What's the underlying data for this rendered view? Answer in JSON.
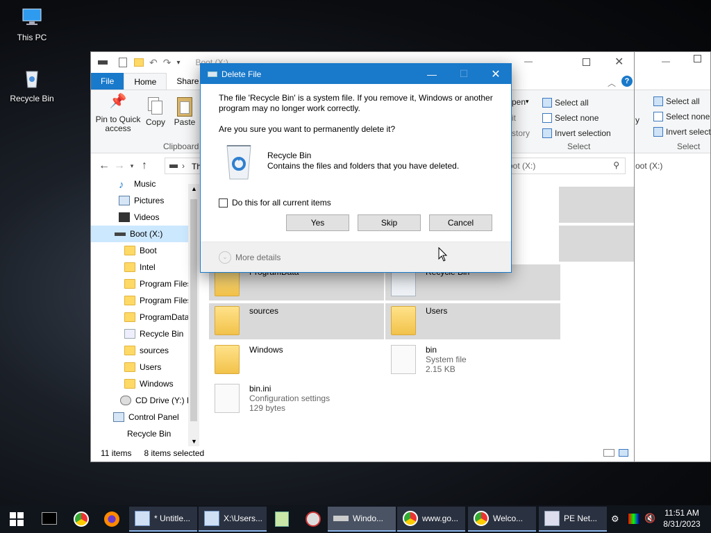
{
  "desktop": {
    "icons": [
      {
        "label": "This PC"
      },
      {
        "label": "Recycle Bin"
      }
    ]
  },
  "explorer": {
    "title": "Boot (X:)",
    "tabs": [
      "File",
      "Home",
      "Share"
    ],
    "ribbon": {
      "pin_label": "Pin to Quick access",
      "copy_label": "Copy",
      "paste_label": "Paste",
      "clipboard_group": "Clipboard",
      "open_partial": "pen",
      "edit_partial": "it",
      "history_partial": "story",
      "select_all": "Select all",
      "select_none": "Select none",
      "invert_selection": "Invert selection",
      "select_group": "Select"
    },
    "address_partial": "Th",
    "search_placeholder": "h Boot (X:)",
    "nav_items": [
      {
        "label": "Music",
        "selected": false
      },
      {
        "label": "Pictures",
        "selected": false
      },
      {
        "label": "Videos",
        "selected": false
      },
      {
        "label": "Boot (X:)",
        "selected": true
      },
      {
        "label": "Boot",
        "selected": false
      },
      {
        "label": "Intel",
        "selected": false
      },
      {
        "label": "Program Files",
        "selected": false
      },
      {
        "label": "Program Files",
        "selected": false
      },
      {
        "label": "ProgramData",
        "selected": false
      },
      {
        "label": "Recycle Bin",
        "selected": false
      },
      {
        "label": "sources",
        "selected": false
      },
      {
        "label": "Users",
        "selected": false
      },
      {
        "label": "Windows",
        "selected": false
      },
      {
        "label": "CD Drive (Y:) H",
        "selected": false
      },
      {
        "label": "Control Panel",
        "selected": false
      },
      {
        "label": "Recycle Bin",
        "selected": false
      }
    ],
    "items": [
      {
        "name": "ProgramData",
        "sub1": "",
        "sub2": "",
        "kind": "folder",
        "selected": true
      },
      {
        "name": "Recycle Bin",
        "sub1": "",
        "sub2": "",
        "kind": "recycle",
        "selected": true
      },
      {
        "name": "sources",
        "sub1": "",
        "sub2": "",
        "kind": "folder",
        "selected": true
      },
      {
        "name": "Users",
        "sub1": "",
        "sub2": "",
        "kind": "folder",
        "selected": true
      },
      {
        "name": "Windows",
        "sub1": "",
        "sub2": "",
        "kind": "folder",
        "selected": false
      },
      {
        "name": "bin",
        "sub1": "System file",
        "sub2": "2.15 KB",
        "kind": "file",
        "selected": false
      },
      {
        "name": "bin.ini",
        "sub1": "Configuration settings",
        "sub2": "129 bytes",
        "kind": "file",
        "selected": false
      }
    ],
    "status_count": "11 items",
    "status_selected": "8 items selected"
  },
  "background_window": {
    "ribbon_select_all": "Select all",
    "ribbon_select_none": "Select none",
    "ribbon_invert": "Invert selecti",
    "ribbon_partial": "y",
    "group_select": "Select",
    "address": "oot (X:)"
  },
  "dialog": {
    "title": "Delete File",
    "message": "The file 'Recycle Bin' is a system file. If you remove it, Windows or another program may no longer work correctly.",
    "question": "Are you sure you want to permanently delete it?",
    "item_name": "Recycle Bin",
    "item_desc": "Contains the files and folders that you have deleted.",
    "checkbox_label": "Do this for all current items",
    "yes": "Yes",
    "skip": "Skip",
    "cancel": "Cancel",
    "more_details": "More details"
  },
  "taskbar": {
    "apps": [
      {
        "label": "* Untitle...",
        "icon": "notepad-icon"
      },
      {
        "label": "X:\\Users...",
        "icon": "notepad-icon"
      },
      {
        "label": "Windo...",
        "icon": "explorer-icon"
      },
      {
        "label": "www.go...",
        "icon": "chrome-icon"
      },
      {
        "label": "Welco...",
        "icon": "chrome-icon"
      },
      {
        "label": "PE Net...",
        "icon": "network-icon"
      }
    ],
    "time": "11:51 AM",
    "date": "8/31/2023"
  },
  "colors": {
    "accent": "#1979ca",
    "selection": "#cce8ff",
    "taskbar": "#10141b"
  }
}
